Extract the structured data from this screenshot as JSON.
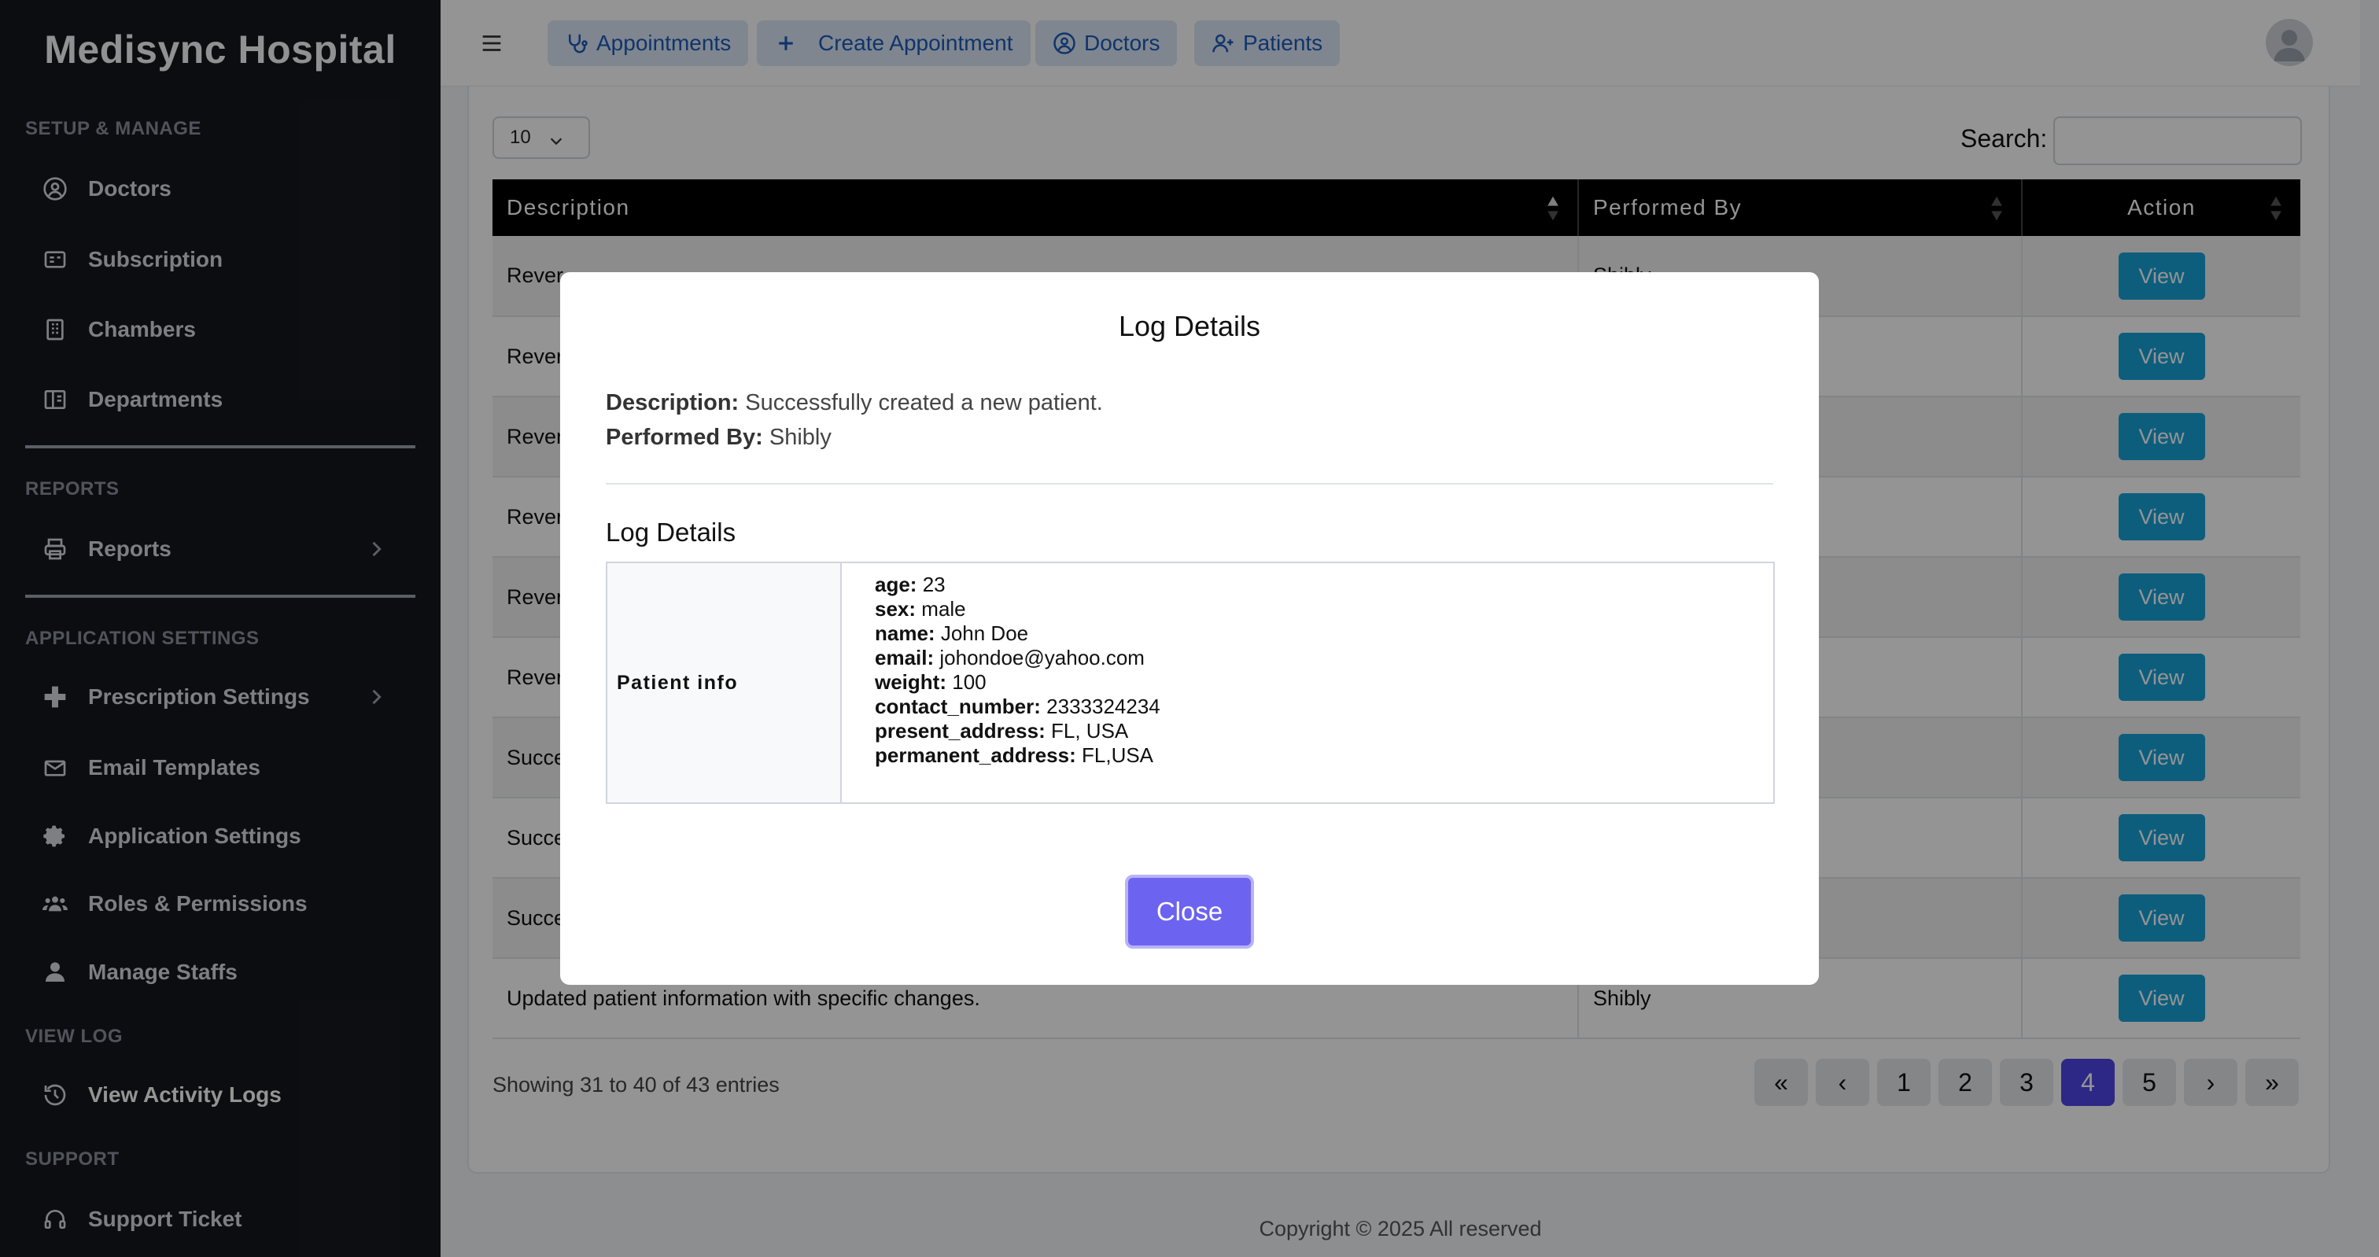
{
  "sidebar": {
    "brand": "Medisync Hospital",
    "sections": {
      "setup": "SETUP & MANAGE",
      "reports": "REPORTS",
      "app_settings": "APPLICATION SETTINGS",
      "view_log": "VIEW LOG",
      "support": "SUPPORT"
    },
    "items": {
      "doctors": "Doctors",
      "subscription": "Subscription",
      "chambers": "Chambers",
      "departments": "Departments",
      "reports": "Reports",
      "prescription_settings": "Prescription Settings",
      "email_templates": "Email Templates",
      "application_settings": "Application Settings",
      "roles_permissions": "Roles & Permissions",
      "manage_staffs": "Manage Staffs",
      "view_activity_logs": "View Activity Logs",
      "support_ticket": "Support Ticket"
    }
  },
  "topbar": {
    "appointments": "Appointments",
    "create_appointment": "Create Appointment",
    "doctors": "Doctors",
    "patients": "Patients"
  },
  "table": {
    "page_length": "10",
    "search_label": "Search:",
    "headers": {
      "description": "Description",
      "performed_by": "Performed By",
      "action": "Action"
    },
    "view_label": "View",
    "rows": [
      {
        "description": "Rever",
        "performed_by": "Shibly"
      },
      {
        "description": "Rever",
        "performed_by": ""
      },
      {
        "description": "Rever",
        "performed_by": ""
      },
      {
        "description": "Rever",
        "performed_by": ""
      },
      {
        "description": "Rever",
        "performed_by": ""
      },
      {
        "description": "Rever",
        "performed_by": ""
      },
      {
        "description": "Succe",
        "performed_by": ""
      },
      {
        "description": "Succe",
        "performed_by": ""
      },
      {
        "description": "Succe",
        "performed_by": ""
      },
      {
        "description": "Updated patient information with specific changes.",
        "performed_by": "Shibly"
      }
    ],
    "showing": "Showing 31 to 40 of 43 entries",
    "pagination": {
      "first": "«",
      "prev": "‹",
      "pages": [
        "1",
        "2",
        "3",
        "4",
        "5"
      ],
      "active_page": "4",
      "next": "›",
      "last": "»"
    }
  },
  "footer": {
    "copyright": "Copyright © 2025 All reserved"
  },
  "modal": {
    "title": "Log Details",
    "description_label": "Description:",
    "description_value": "Successfully created a new patient.",
    "performed_by_label": "Performed By:",
    "performed_by_value": "Shibly",
    "subtitle": "Log Details",
    "detail_key": "Patient info",
    "fields": [
      {
        "key": "age:",
        "value": "23"
      },
      {
        "key": "sex:",
        "value": "male"
      },
      {
        "key": "name:",
        "value": "John Doe"
      },
      {
        "key": "email:",
        "value": "johondoe@yahoo.com"
      },
      {
        "key": "weight:",
        "value": "100"
      },
      {
        "key": "contact_number:",
        "value": "2333324234"
      },
      {
        "key": "present_address:",
        "value": "FL, USA"
      },
      {
        "key": "permanent_address:",
        "value": "FL,USA"
      }
    ],
    "close_label": "Close"
  },
  "colors": {
    "sidebar_bg": "#16181d",
    "accent": "#6c63f0",
    "view_button": "#17a2d8",
    "active_page": "#4f46e5"
  }
}
